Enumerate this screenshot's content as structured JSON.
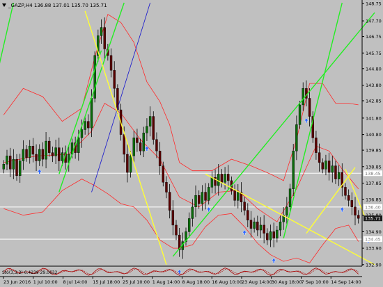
{
  "window": {
    "symbol_line": "_GAZP,H4 136.88 137.01 135.70 135.71",
    "menu_icon": "triangle-down-icon"
  },
  "colors": {
    "background": "#c0c0c0",
    "candle_up": "#0b6d0b",
    "candle_down": "#5a0000",
    "bollinger": "#ff2a2a",
    "trend_green": "#22ee22",
    "trend_yellow": "#ffff33",
    "trend_blue": "#2222cc",
    "hline": "#ffffff",
    "arrow": "#2b66ff",
    "oscillator": "#aa0000",
    "price_box": "#1a1a1a"
  },
  "chart_data": {
    "type": "candlestick",
    "symbol": "_GAZP",
    "timeframe": "H4",
    "ohlc_header": {
      "open": 136.88,
      "high": 137.01,
      "low": 135.7,
      "close": 135.71
    },
    "price_range": [
      132.85,
      148.8
    ],
    "price_ticks": [
      "148.75",
      "147.70",
      "146.75",
      "145.75",
      "144.80",
      "143.80",
      "142.85",
      "141.80",
      "140.80",
      "139.85",
      "138.85",
      "137.85",
      "136.85",
      "135.90",
      "134.90",
      "133.90",
      "132.90"
    ],
    "hline_prices": [
      138.45,
      136.4,
      134.45
    ],
    "hline_labels": [
      "138.45",
      "136.40",
      "134.45"
    ],
    "current_price": "135.71",
    "time_labels": [
      "23 Jun 2016",
      "1 Jul 10:00",
      "8 Jul 14:00",
      "15 Jul 18:00",
      "25 Jul 10:00",
      "1 Aug 14:00",
      "8 Aug 18:00",
      "16 Aug 10:00",
      "23 Aug 14:00",
      "30 Aug 18:00",
      "7 Sep 10:00",
      "14 Sep 14:00"
    ],
    "closes": [
      139.0,
      139.5,
      138.7,
      139.3,
      138.3,
      139.2,
      139.9,
      139.4,
      140.1,
      139.6,
      139.2,
      139.9,
      139.3,
      140.4,
      139.7,
      139.5,
      140.0,
      139.2,
      139.7,
      139.1,
      139.6,
      140.3,
      139.7,
      140.6,
      141.1,
      141.6,
      141.2,
      143.0,
      145.6,
      146.8,
      147.3,
      146.0,
      145.6,
      144.7,
      143.6,
      142.3,
      140.8,
      139.6,
      138.5,
      139.5,
      140.6,
      140.3,
      139.8,
      140.9,
      141.3,
      141.9,
      140.5,
      139.8,
      138.9,
      137.9,
      137.3,
      136.2,
      135.3,
      134.7,
      133.8,
      134.3,
      134.9,
      135.7,
      136.4,
      137.1,
      136.6,
      137.3,
      136.8,
      137.6,
      138.2,
      137.7,
      138.4,
      137.9,
      138.4,
      138.0,
      137.4,
      136.8,
      137.3,
      136.7,
      136.2,
      135.6,
      135.1,
      135.5,
      135.0,
      135.3,
      134.8,
      134.4,
      134.9,
      134.5,
      135.0,
      135.5,
      135.9,
      136.4,
      137.5,
      139.8,
      141.4,
      142.6,
      143.6,
      143.0,
      141.9,
      140.6,
      139.7,
      139.1,
      138.7,
      139.2,
      138.5,
      138.9,
      138.1,
      138.5,
      137.6,
      137.1,
      136.8,
      136.4,
      135.9,
      135.71
    ],
    "bollinger_mid": [
      [
        0,
        139.1
      ],
      [
        10,
        139.5
      ],
      [
        20,
        139.6
      ],
      [
        27,
        141.0
      ],
      [
        31,
        142.7
      ],
      [
        36,
        142.1
      ],
      [
        42,
        140.5
      ],
      [
        48,
        139.3
      ],
      [
        54,
        137.0
      ],
      [
        60,
        136.4
      ],
      [
        66,
        137.3
      ],
      [
        72,
        137.4
      ],
      [
        78,
        136.3
      ],
      [
        84,
        135.5
      ],
      [
        90,
        137.5
      ],
      [
        96,
        140.1
      ],
      [
        100,
        139.8
      ],
      [
        104,
        138.7
      ],
      [
        109,
        137.5
      ]
    ],
    "bollinger_upper": [
      [
        0,
        142.0
      ],
      [
        6,
        143.6
      ],
      [
        12,
        143.1
      ],
      [
        18,
        141.6
      ],
      [
        24,
        142.4
      ],
      [
        28,
        145.5
      ],
      [
        32,
        148.1
      ],
      [
        36,
        147.6
      ],
      [
        40,
        146.4
      ],
      [
        44,
        144.0
      ],
      [
        48,
        142.8
      ],
      [
        51,
        141.4
      ],
      [
        54,
        139.1
      ],
      [
        58,
        138.6
      ],
      [
        64,
        138.6
      ],
      [
        70,
        139.3
      ],
      [
        76,
        138.9
      ],
      [
        82,
        138.4
      ],
      [
        86,
        138.0
      ],
      [
        90,
        140.5
      ],
      [
        94,
        143.9
      ],
      [
        98,
        143.9
      ],
      [
        102,
        142.7
      ],
      [
        106,
        142.7
      ],
      [
        109,
        142.6
      ]
    ],
    "bollinger_lower": [
      [
        0,
        136.3
      ],
      [
        6,
        135.9
      ],
      [
        12,
        136.1
      ],
      [
        18,
        137.4
      ],
      [
        24,
        138.1
      ],
      [
        28,
        137.7
      ],
      [
        32,
        137.2
      ],
      [
        36,
        136.6
      ],
      [
        40,
        136.4
      ],
      [
        44,
        135.6
      ],
      [
        48,
        134.4
      ],
      [
        52,
        133.9
      ],
      [
        54,
        133.9
      ],
      [
        58,
        134.1
      ],
      [
        62,
        135.2
      ],
      [
        66,
        135.9
      ],
      [
        70,
        136.0
      ],
      [
        74,
        135.2
      ],
      [
        78,
        134.2
      ],
      [
        82,
        133.5
      ],
      [
        86,
        133.1
      ],
      [
        90,
        133.3
      ],
      [
        94,
        133.0
      ],
      [
        98,
        134.1
      ],
      [
        102,
        135.1
      ],
      [
        106,
        135.3
      ],
      [
        109,
        134.3
      ]
    ],
    "trendlines": [
      {
        "color": "green",
        "points": [
          [
            17,
            137.3
          ],
          [
            37,
            148.8
          ]
        ]
      },
      {
        "color": "green",
        "points": [
          [
            -2,
            144.5
          ],
          [
            3,
            148.8
          ]
        ]
      },
      {
        "color": "green",
        "points": [
          [
            17,
            138.4
          ],
          [
            30,
            145.9
          ]
        ]
      },
      {
        "color": "green",
        "points": [
          [
            52,
            133.4
          ],
          [
            114,
            148.2
          ]
        ]
      },
      {
        "color": "green",
        "points": [
          [
            86,
            134.5
          ],
          [
            104,
            148.8
          ]
        ]
      },
      {
        "color": "blue",
        "points": [
          [
            27,
            137.3
          ],
          [
            45,
            148.8
          ]
        ]
      },
      {
        "color": "yellow",
        "points": [
          [
            25,
            148.3
          ],
          [
            50,
            132.9
          ]
        ]
      },
      {
        "color": "yellow",
        "points": [
          [
            62,
            138.4
          ],
          [
            114,
            132.9
          ]
        ]
      },
      {
        "color": "yellow",
        "points": [
          [
            93,
            134.8
          ],
          [
            108,
            138.8
          ]
        ]
      },
      {
        "color": "yellow",
        "points": [
          [
            105,
            138.7
          ],
          [
            111,
            135.8
          ]
        ]
      }
    ],
    "arrow_markers": [
      11,
      44,
      54,
      63,
      74,
      83,
      93,
      104,
      112
    ],
    "oscillator": {
      "label": "Sto(3,3,3) 6.4239 29.0632",
      "range": [
        0,
        100
      ]
    }
  }
}
